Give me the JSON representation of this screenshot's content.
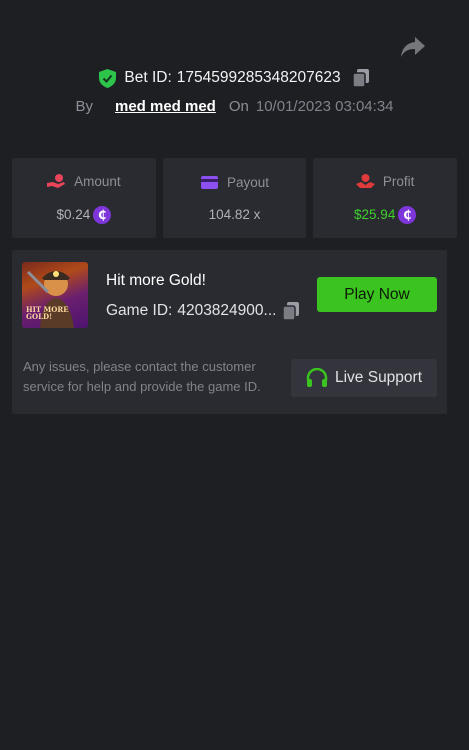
{
  "header": {
    "share_icon": "share-arrow-icon",
    "bet_id_label": "Bet ID:",
    "bet_id": "1754599285348207623",
    "by_label": "By",
    "username": "med med med",
    "on_label": "On",
    "date": "10/01/2023 03:04:34"
  },
  "stats": [
    {
      "label": "Amount",
      "value": "$0.24",
      "icon": "hand-coin-icon",
      "icon_color": "#e8445a",
      "has_coin": true
    },
    {
      "label": "Payout",
      "value": "104.82 x",
      "icon": "card-icon",
      "icon_color": "#8c4ff0",
      "has_coin": false
    },
    {
      "label": "Profit",
      "value": "$25.94",
      "icon": "hand-coin-icon",
      "icon_color": "#e03a3a",
      "has_coin": true,
      "value_color": "#3dd12c"
    }
  ],
  "coin_symbol": "₵",
  "game": {
    "thumb_text_line1": "HIT MORE",
    "thumb_text_line2": "GOLD!",
    "title": "Hit more Gold!",
    "game_id_label": "Game ID:",
    "game_id": "4203824900...",
    "play_label": "Play Now"
  },
  "support": {
    "text": "Any issues, please contact the customer service for help and provide the game ID.",
    "button_label": "Live Support"
  },
  "colors": {
    "background": "#1e1f23",
    "panel": "#2a2b31",
    "accent_green": "#3bc41f",
    "coin_purple": "#7d36d9"
  }
}
